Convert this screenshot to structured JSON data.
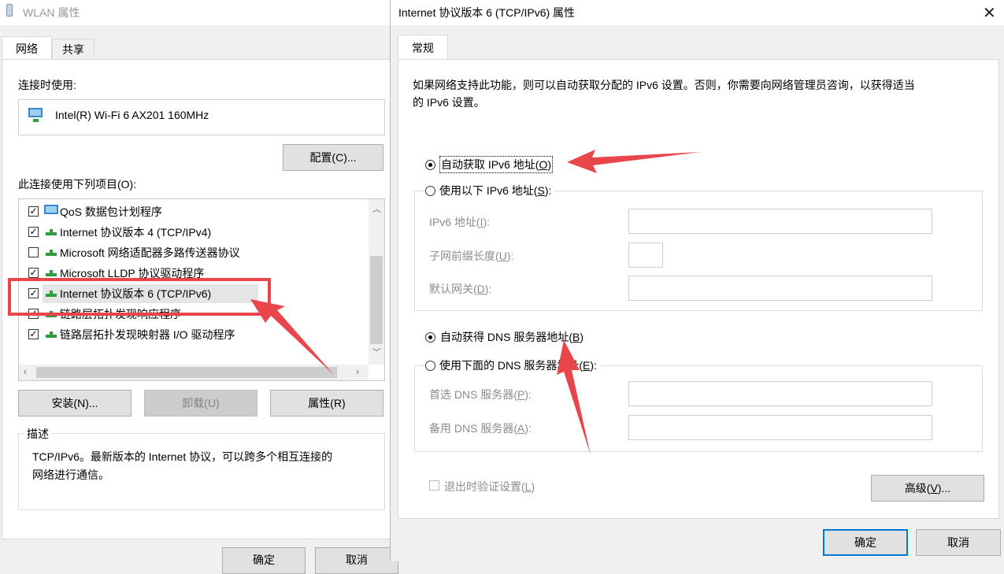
{
  "left_dialog": {
    "title": "WLAN 属性",
    "tabs": [
      "网络",
      "共享"
    ],
    "connect_using_label": "连接时使用:",
    "adapter_name": "Intel(R) Wi-Fi 6 AX201 160MHz",
    "configure_button": "配置(C)...",
    "items_label": "此连接使用下列项目(O):",
    "items": [
      {
        "label": "QoS 数据包计划程序",
        "checked": true,
        "icon": "qos-monitor-icon"
      },
      {
        "label": "Internet 协议版本 4 (TCP/IPv4)",
        "checked": true,
        "icon": "network-protocol-icon"
      },
      {
        "label": "Microsoft 网络适配器多路传送器协议",
        "checked": false,
        "icon": "network-protocol-icon"
      },
      {
        "label": "Microsoft LLDP 协议驱动程序",
        "checked": true,
        "icon": "network-protocol-icon"
      },
      {
        "label": "Internet 协议版本 6 (TCP/IPv6)",
        "checked": true,
        "icon": "network-protocol-icon",
        "selected": true
      },
      {
        "label": "链路层拓扑发现响应程序",
        "checked": true,
        "icon": "network-protocol-icon"
      },
      {
        "label": "链路层拓扑发现映射器 I/O 驱动程序",
        "checked": true,
        "icon": "network-protocol-icon"
      }
    ],
    "install_button": "安装(N)...",
    "uninstall_button": "卸载(U)",
    "properties_button": "属性(R)",
    "description_label": "描述",
    "description_text_line1": "TCP/IPv6。最新版本的 Internet 协议，可以跨多个相互连接的",
    "description_text_line2": "网络进行通信。",
    "ok_button": "确定",
    "cancel_button": "取消"
  },
  "right_dialog": {
    "title": "Internet 协议版本 6 (TCP/IPv6) 属性",
    "close_icon": "close-icon",
    "tab": "常规",
    "intro_line1": "如果网络支持此功能，则可以自动获取分配的 IPv6 设置。否则，你需要向网络管理员咨询，以获得适当",
    "intro_line2": "的 IPv6 设置。",
    "auto_ip": {
      "prefix": "自动获取 IPv6 地址(",
      "key": "O",
      "suffix": ")",
      "selected": true
    },
    "manual_ip": {
      "prefix": "使用以下 IPv6 地址(",
      "key": "S",
      "suffix": "):",
      "selected": false
    },
    "ipv6_address_label": {
      "prefix": "IPv6 地址(",
      "key": "I",
      "suffix": "):"
    },
    "prefix_length_label": {
      "prefix": "子网前缀长度(",
      "key": "U",
      "suffix": "):"
    },
    "gateway_label": {
      "prefix": "默认网关(",
      "key": "D",
      "suffix": "):"
    },
    "auto_dns": {
      "prefix": "自动获得 DNS 服务器地址(",
      "key": "B",
      "suffix": ")",
      "selected": true
    },
    "manual_dns": {
      "prefix": "使用下面的 DNS 服务器地址(",
      "key": "E",
      "suffix": "):",
      "selected": false
    },
    "preferred_dns_label": {
      "prefix": "首选 DNS 服务器(",
      "key": "P",
      "suffix": "):"
    },
    "alternate_dns_label": {
      "prefix": "备用 DNS 服务器(",
      "key": "A",
      "suffix": "):"
    },
    "validate_on_exit": {
      "prefix": "退出时验证设置(",
      "key": "L",
      "suffix": ")",
      "checked": false
    },
    "advanced_button": {
      "prefix": "高级(",
      "key": "V",
      "suffix": ")..."
    },
    "ok_button": "确定",
    "cancel_button": "取消"
  },
  "annotations": {
    "color": "#e8464a"
  }
}
